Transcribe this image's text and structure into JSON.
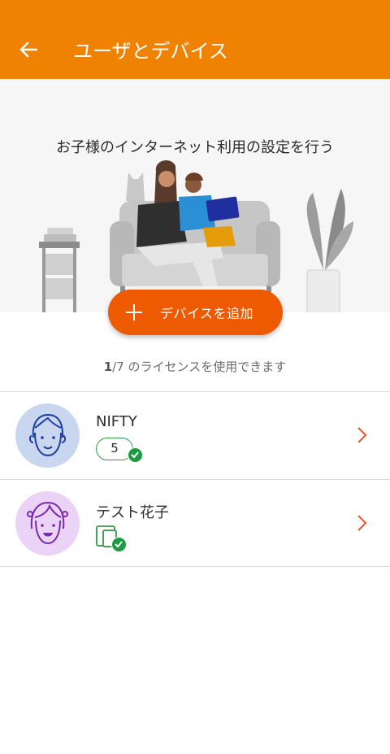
{
  "header": {
    "title": "ユーザとデバイス",
    "back_icon": "arrow-left-icon"
  },
  "hero": {
    "text": "お子様のインターネット利用の設定を行う"
  },
  "add_device": {
    "label": "デバイスを追加",
    "icon": "plus-icon"
  },
  "license": {
    "used": "1",
    "rest": "/7 のライセンスを使用できます"
  },
  "users": [
    {
      "name": "NIFTY",
      "device_count": "5",
      "avatar_color": "#c9d6ef"
    },
    {
      "name": "テスト花子",
      "device_count": "",
      "avatar_color": "#ead3f7"
    }
  ],
  "colors": {
    "appbar": "#ef8200",
    "primary_button": "#ee5a00",
    "status_green": "#1d9b42",
    "chevron": "#e8562a"
  }
}
